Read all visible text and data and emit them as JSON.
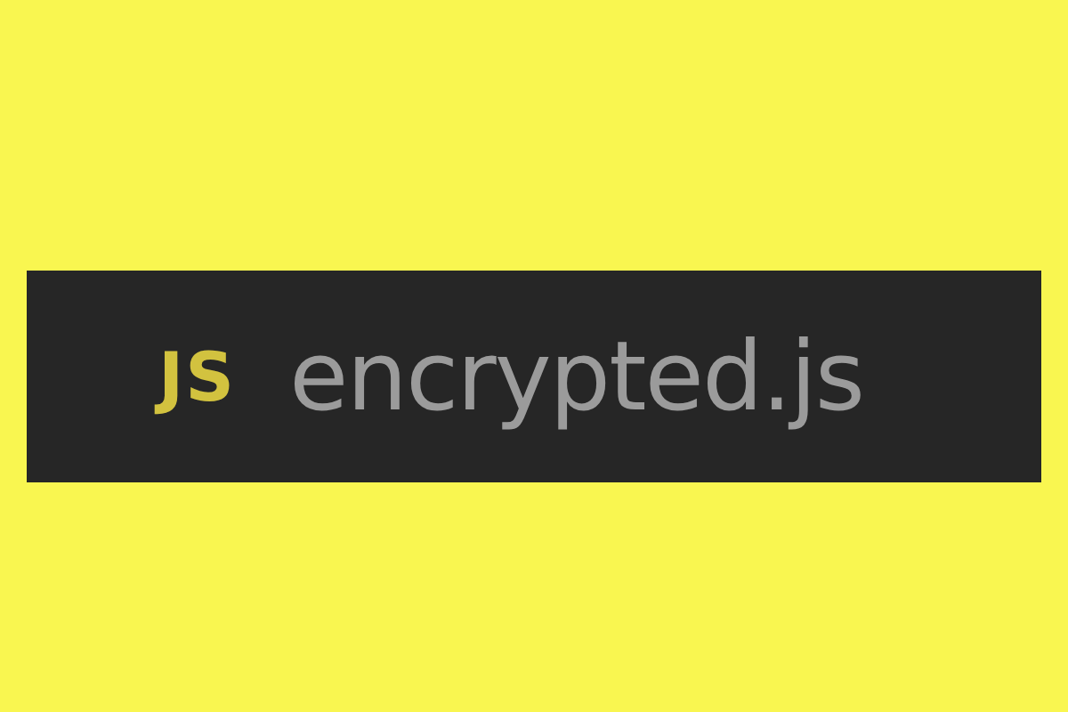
{
  "file_tab": {
    "language_badge": "JS",
    "filename": "encrypted.js"
  }
}
